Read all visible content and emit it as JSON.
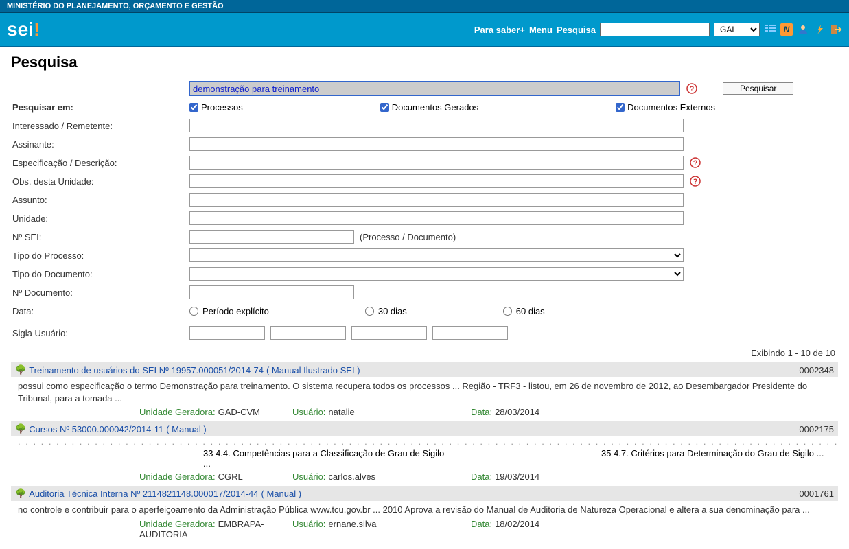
{
  "top_bar": "MINISTÉRIO DO PLANEJAMENTO, ORÇAMENTO E GESTÃO",
  "logo_text": "sei",
  "logo_suffix": "!",
  "header": {
    "para_saber": "Para saber+",
    "menu": "Menu",
    "pesquisa": "Pesquisa",
    "unit_selected": "GAL"
  },
  "page_title": "Pesquisa",
  "search_value": "demonstração para treinamento",
  "btn_pesquisar": "Pesquisar",
  "labels": {
    "pesquisar_em": "Pesquisar em:",
    "interessado": "Interessado / Remetente:",
    "assinante": "Assinante:",
    "especificacao": "Especificação / Descrição:",
    "obs": "Obs. desta Unidade:",
    "assunto": "Assunto:",
    "unidade": "Unidade:",
    "n_sei": "Nº SEI:",
    "tipo_processo": "Tipo do Processo:",
    "tipo_documento": "Tipo do Documento:",
    "n_documento": "Nº Documento:",
    "data": "Data:",
    "sigla": "Sigla Usuário:"
  },
  "checks": {
    "processos": "Processos",
    "docs_gerados": "Documentos Gerados",
    "docs_externos": "Documentos Externos"
  },
  "n_sei_note": "(Processo / Documento)",
  "radios": {
    "explicito": "Período explícito",
    "d30": "30 dias",
    "d60": "60 dias"
  },
  "results_summary": "Exibindo 1 - 10 de 10",
  "meta_labels": {
    "unidade": "Unidade Geradora:",
    "usuario": "Usuário:",
    "data": "Data:"
  },
  "results": [
    {
      "title": "Treinamento de usuários do SEI Nº 19957.000051/2014-74",
      "paren": "( Manual Ilustrado SEI )",
      "num": "0002348",
      "snippet": "possui como especificação o termo Demonstração para treinamento. O sistema recupera todos os processos  ...   Região - TRF3 - listou, em 26 de novembro de 2012, ao Desembargador Presidente do Tribunal, para a tomada  ...",
      "unidade": "GAD-CVM",
      "usuario": "natalie",
      "data": "28/03/2014"
    },
    {
      "title": "Cursos Nº 53000.000042/2014-11",
      "paren": "( Manual )",
      "num": "0002175",
      "snip1": "33 4.4. Competências para a Classificação de Grau de Sigilo  ...",
      "snip2": "35 4.7. Critérios para Determinação do Grau de Sigilo  ...",
      "unidade": "CGRL",
      "usuario": "carlos.alves",
      "data": "19/03/2014"
    },
    {
      "title": "Auditoria Técnica Interna Nº 2114821148.000017/2014-44",
      "paren": "( Manual )",
      "num": "0001761",
      "snippet": "no controle e contribuir para o aperfeiçoamento da Administração Pública www.tcu.gov.br  ...   2010 Aprova a revisão do Manual de Auditoria de Natureza Operacional e altera a sua denominação para  ...",
      "unidade": "EMBRAPA-AUDITORIA",
      "usuario": "ernane.silva",
      "data": "18/02/2014"
    }
  ]
}
